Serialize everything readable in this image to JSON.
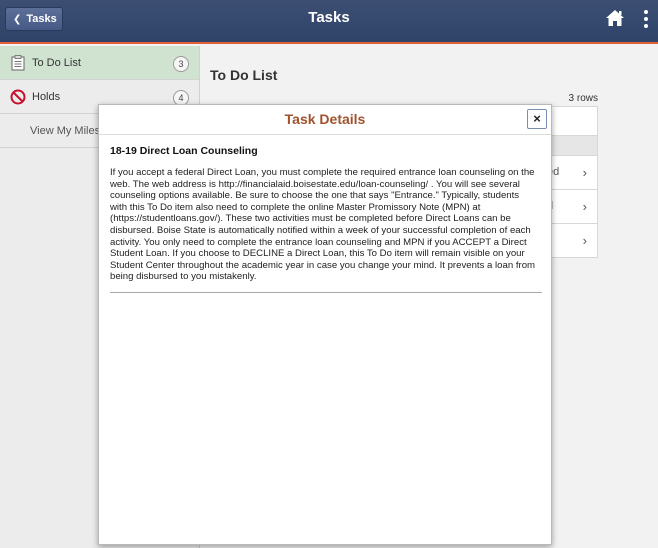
{
  "header": {
    "back_label": "Tasks",
    "title": "Tasks",
    "color_bar": "#34476d",
    "accent": "#e2603a"
  },
  "sidebar": {
    "items": [
      {
        "label": "To Do List",
        "count": "3",
        "icon": "clipboard-icon"
      },
      {
        "label": "Holds",
        "count": "4",
        "icon": "prohibited-icon"
      },
      {
        "label": "View My Milest"
      }
    ]
  },
  "main": {
    "title": "To Do List",
    "rows_count": "3 rows",
    "row_fragments": [
      "ed",
      "d",
      "l"
    ]
  },
  "modal": {
    "title": "Task Details",
    "close_label": "×",
    "task_title": "18-19 Direct Loan Counseling",
    "task_description": "If you accept a federal Direct Loan, you must complete the required entrance loan counseling on the web. The web address is http://financialaid.boisestate.edu/loan-counseling/ . You will see several counseling options available. Be sure to choose the one that says \"Entrance.\" Typically, students with this To Do item also need to complete the online Master Promissory Note (MPN) at (https://studentloans.gov/). These two activities must be completed before Direct Loans can be disbursed. Boise State is automatically notified within a week of your successful completion of each activity. You only need to complete the entrance loan counseling and MPN if you ACCEPT a Direct Student Loan. If you choose to DECLINE a Direct Loan, this To Do item will remain visible on your Student Center throughout the academic year in case you change your mind. It prevents a loan from being disbursed to you mistakenly.",
    "title_color": "#a0522d"
  }
}
